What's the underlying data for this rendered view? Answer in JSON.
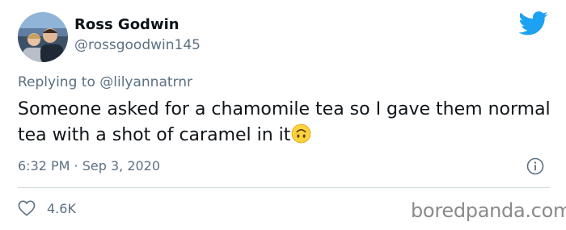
{
  "author": {
    "display_name": "Ross Godwin",
    "handle": "@rossgoodwin145"
  },
  "reply": {
    "prefix": "Replying to ",
    "mention": "@lilyannatrnr"
  },
  "tweet": {
    "text": "Someone asked for a chamomile tea so I gave them normal tea with a shot of caramel in it",
    "emoji": "upside-down-face-icon"
  },
  "meta": {
    "timestamp": "6:32 PM · Sep 3, 2020"
  },
  "engagement": {
    "likes": "4.6K"
  },
  "watermark": "boredpanda.com",
  "colors": {
    "twitter_blue": "#1da1f2",
    "secondary_text": "#5b7083",
    "primary_text": "#0f1419",
    "emoji_yellow": "#fdd33c"
  }
}
